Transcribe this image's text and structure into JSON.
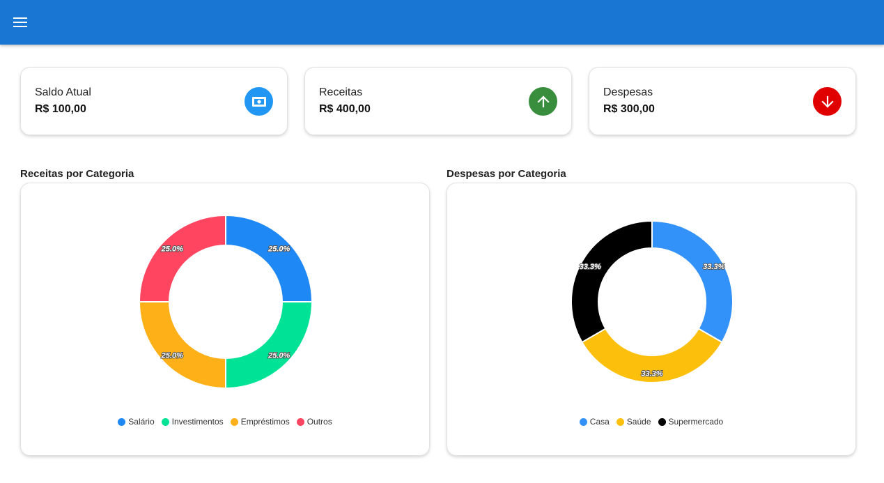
{
  "summary": [
    {
      "title": "Saldo Atual",
      "value": "R$ 100,00",
      "icon": "money-icon",
      "color": "#2196f3"
    },
    {
      "title": "Receitas",
      "value": "R$ 400,00",
      "icon": "arrow-up-icon",
      "color": "#388e3c"
    },
    {
      "title": "Despesas",
      "value": "R$ 300,00",
      "icon": "arrow-down-icon",
      "color": "#e00000"
    }
  ],
  "charts": {
    "income": {
      "title": "Receitas por Categoria"
    },
    "expense": {
      "title": "Despesas por Categoria"
    }
  },
  "chart_data": [
    {
      "type": "pie",
      "title": "Receitas por Categoria",
      "categories": [
        "Salário",
        "Investimentos",
        "Empréstimos",
        "Outros"
      ],
      "values": [
        25.0,
        25.0,
        25.0,
        25.0
      ],
      "labels": [
        "25.0%",
        "25.0%",
        "25.0%",
        "25.0%"
      ],
      "colors": [
        "#1e88f5",
        "#00e396",
        "#feb019",
        "#ff4560"
      ],
      "legend": "bottom"
    },
    {
      "type": "pie",
      "title": "Despesas por Categoria",
      "categories": [
        "Casa",
        "Saúde",
        "Supermercado"
      ],
      "values": [
        33.3,
        33.3,
        33.3
      ],
      "labels": [
        "33.3%",
        "33.3%",
        "33.3%"
      ],
      "colors": [
        "#3392fa",
        "#fcbf0b",
        "#000000"
      ],
      "legend": "bottom"
    }
  ]
}
